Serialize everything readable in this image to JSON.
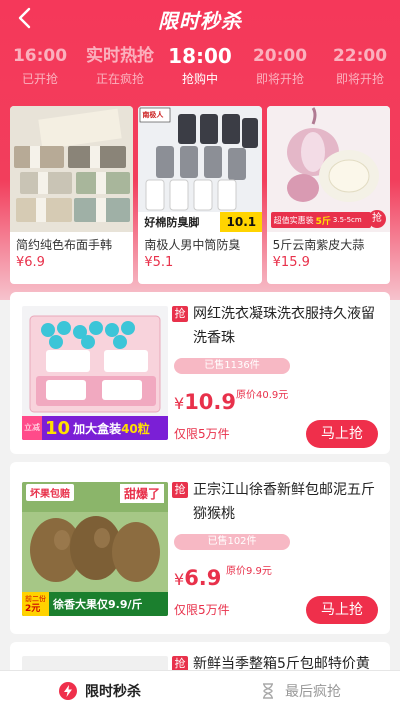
{
  "header": {
    "title": "限时秒杀"
  },
  "slots": [
    {
      "time": "16:00",
      "status": "已开抢"
    },
    {
      "time": "实时热抢",
      "status": "正在疯抢"
    },
    {
      "time": "18:00",
      "status": "抢购中"
    },
    {
      "time": "20:00",
      "status": "即将开抢"
    },
    {
      "time": "22:00",
      "status": "即将开抢"
    }
  ],
  "top_cards": [
    {
      "name": "简约纯色布面手韩",
      "price": "¥6.9"
    },
    {
      "name": "南极人男中筒防臭",
      "price": "¥5.1",
      "overlay": "好棉防臭脚",
      "overlay_price": "10.1",
      "brand": "南极人"
    },
    {
      "name": "5斤云南紫皮大蒜",
      "price": "¥15.9",
      "overlay": "超值实惠装",
      "overlay_weight": "5斤",
      "overlay_size": "3.5-5cm",
      "badge": "抢"
    }
  ],
  "items": [
    {
      "badge": "抢",
      "name": "网红洗衣凝珠洗衣服持久液留洗香珠",
      "sold": "已售1136件",
      "currency": "¥",
      "price": "10.9",
      "orig": "原价40.9元",
      "limit": "仅限5万件",
      "buy": "马上抢",
      "banner_text": "加大盒装",
      "banner_count": "40粒",
      "banner_left": "立减",
      "banner_num": "10"
    },
    {
      "badge": "抢",
      "name": "正宗江山徐香新鲜包邮泥五斤猕猴桃",
      "sold": "已售102件",
      "currency": "¥",
      "price": "6.9",
      "orig": "原价9.9元",
      "limit": "仅限5万件",
      "buy": "马上抢",
      "tag_left": "坏果包赔",
      "tag_right": "甜爆了",
      "banner_text": "徐香大果仅9.9/斤",
      "banner_left": "前二份",
      "banner_num": "2元"
    },
    {
      "badge": "抢",
      "name": "新鲜当季整箱5斤包邮特价黄"
    }
  ],
  "tabbar": [
    {
      "label": "限时秒杀"
    },
    {
      "label": "最后疯抢"
    }
  ],
  "colors": {
    "accent": "#ef2f4b",
    "header": "#f5385a"
  }
}
